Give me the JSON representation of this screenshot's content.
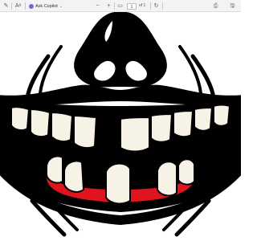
{
  "toolbar": {
    "draw_icon": "draw-pen-icon",
    "read_aloud_icon": "read-aloud-icon",
    "copilot_label": "Ask Copilot",
    "copilot_chevron": "chevron-down-icon",
    "zoom_out_icon": "minus-icon",
    "zoom_in_icon": "plus-icon",
    "fit_page_icon": "fit-page-icon",
    "page_number": "1",
    "page_total": "of 1",
    "rotate_icon": "rotate-icon",
    "print_icon": "print-icon",
    "save_icon": "save-icon"
  },
  "document": {
    "image_subject": "skull-mouth-illustration",
    "colors": {
      "ink": "#000000",
      "teeth": "#f6f2e6",
      "gum": "#e0141e",
      "paper": "#ffffff"
    }
  }
}
